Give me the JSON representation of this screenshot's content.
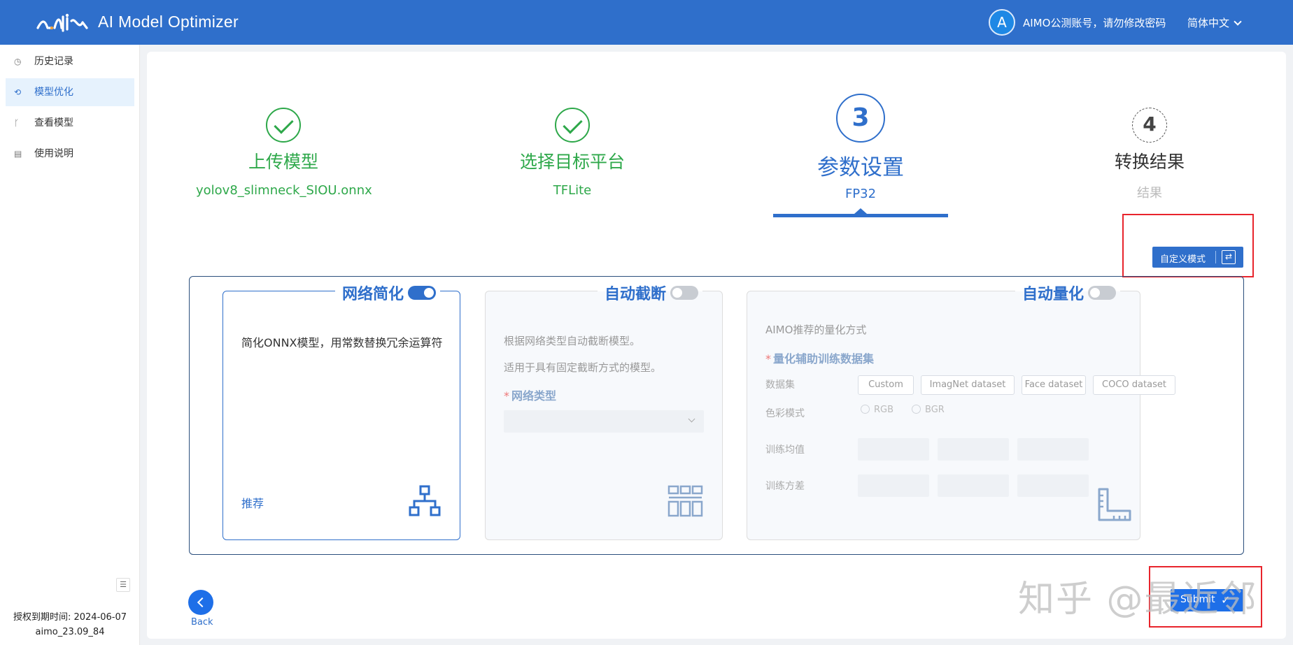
{
  "header": {
    "app_title": "AI Model Optimizer",
    "avatar_letter": "A",
    "account": "AIMO公测账号，请勿修改密码",
    "language": "简体中文"
  },
  "sidebar": {
    "items": [
      {
        "label": "历史记录",
        "icon": "clock-icon"
      },
      {
        "label": "模型优化",
        "icon": "refresh-icon",
        "active": true
      },
      {
        "label": "查看模型",
        "icon": "branch-icon"
      },
      {
        "label": "使用说明",
        "icon": "document-icon"
      }
    ],
    "license": "授权到期时间: 2024-06-07",
    "version": "aimo_23.09_84"
  },
  "steps": [
    {
      "number": "1",
      "title": "上传模型",
      "subtitle": "yolov8_slimneck_SIOU.onnx",
      "status": "done"
    },
    {
      "number": "2",
      "title": "选择目标平台",
      "subtitle": "TFLite",
      "status": "done"
    },
    {
      "number": "3",
      "title": "参数设置",
      "subtitle": "FP32",
      "status": "current"
    },
    {
      "number": "4",
      "title": "转换结果",
      "subtitle": "结果",
      "status": "pending"
    }
  ],
  "mode_button": "自定义模式",
  "cards": {
    "simplify": {
      "title": "网络简化",
      "enabled": true,
      "description": "简化ONNX模型，用常数替换冗余运算符",
      "recommend": "推荐"
    },
    "truncate": {
      "title": "自动截断",
      "enabled": false,
      "line1": "根据网络类型自动截断模型。",
      "line2": "适用于具有固定截断方式的模型。",
      "network_type_label": "网络类型",
      "network_type_value": ""
    },
    "quantize": {
      "title": "自动量化",
      "enabled": false,
      "intro": "AIMO推荐的量化方式",
      "dataset_section": "量化辅助训练数据集",
      "dataset_label": "数据集",
      "datasets": [
        "Custom",
        "ImagNet dataset",
        "Face dataset",
        "COCO dataset"
      ],
      "color_label": "色彩模式",
      "color_options": [
        "RGB",
        "BGR"
      ],
      "mean_label": "训练均值",
      "std_label": "训练方差"
    }
  },
  "footer": {
    "back": "Back",
    "submit": "Submit"
  },
  "watermark": "知乎 @最近邻",
  "colors": {
    "primary": "#2f6fcb",
    "success": "#2ea84a",
    "highlight": "#e8242c"
  }
}
